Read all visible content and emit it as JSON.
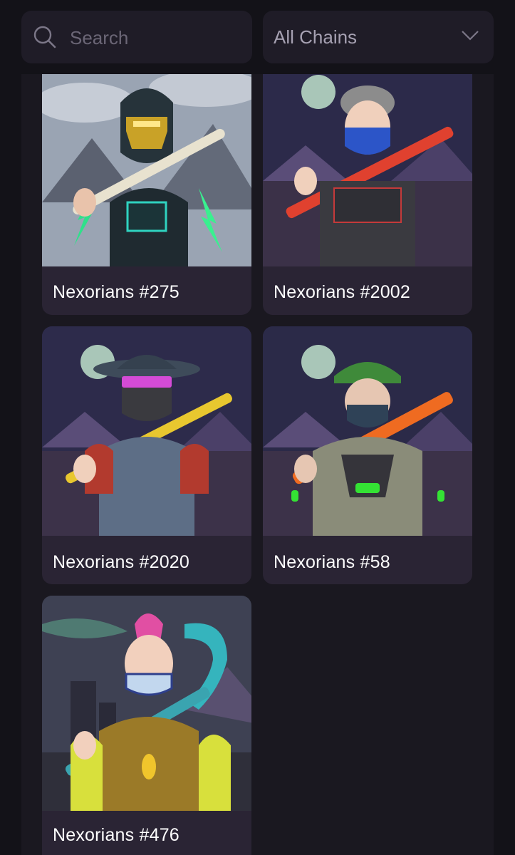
{
  "search": {
    "placeholder": "Search",
    "icon": "search-icon"
  },
  "chain_filter": {
    "selected": "All Chains",
    "icon": "chevron-down-icon"
  },
  "collection": [
    {
      "name": "Nexorians #275",
      "art": "nexorian-275-artwork"
    },
    {
      "name": "Nexorians #2002",
      "art": "nexorian-2002-artwork"
    },
    {
      "name": "Nexorians #2020",
      "art": "nexorian-2020-artwork"
    },
    {
      "name": "Nexorians #58",
      "art": "nexorian-58-artwork"
    },
    {
      "name": "Nexorians #476",
      "art": "nexorian-476-artwork"
    }
  ],
  "colors": {
    "background": "#131218",
    "panel": "#1a1820",
    "card": "#2a2434",
    "input": "#1f1c27",
    "text": "#ffffff",
    "muted": "#a6a1b2"
  }
}
